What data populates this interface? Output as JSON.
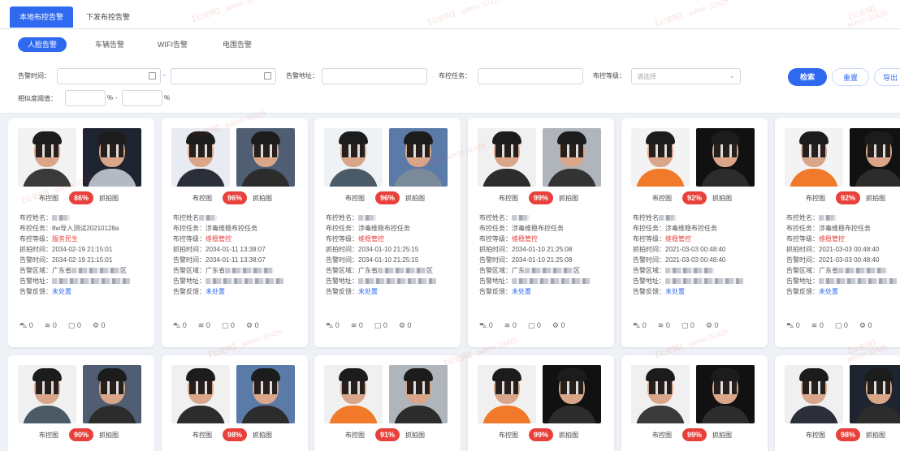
{
  "top_tabs": [
    {
      "label": "本地布控告警",
      "active": true
    },
    {
      "label": "下发布控告警",
      "active": false
    }
  ],
  "sub_tabs": [
    {
      "label": "人脸告警",
      "active": true
    },
    {
      "label": "车辆告警",
      "active": false
    },
    {
      "label": "WIFI告警",
      "active": false
    },
    {
      "label": "电围告警",
      "active": false
    }
  ],
  "filters": {
    "alarm_time_label": "告警时间：",
    "range_sep": "-",
    "alarm_addr_label": "告警地址：",
    "task_label": "布控任务：",
    "level_label": "布控等级：",
    "level_placeholder": "请选择",
    "similarity_label": "相似度阈值：",
    "percent_sign": "%",
    "search_label": "检索",
    "reset_label": "重置",
    "export_label": "导出"
  },
  "watermark": "【公安网】 admin 32425",
  "cards_row1": [
    {
      "caption_left": "布控图",
      "percent": "86%",
      "caption_right": "抓拍图",
      "name_label": "布控姓名：",
      "task_label": "布控任务：",
      "task": "8w导入测试20210128a",
      "level_label": "布控等级：",
      "level": "服务民生",
      "capture_time_label": "抓拍时间：",
      "capture_time": "2034-02-19 21:15:01",
      "alarm_time_label": "告警时间：",
      "alarm_time": "2034-02-19 21:15:01",
      "region_label": "告警区域：",
      "region": "广东省",
      "region_suffix": "区",
      "addr_label": "告警地址：",
      "feedback_label": "告警反馈：",
      "feedback": "未处置",
      "counts": [
        "0",
        "0",
        "0",
        "0"
      ]
    },
    {
      "caption_left": "布控图",
      "percent": "96%",
      "caption_right": "抓拍图",
      "name_label": "布控姓名",
      "task_label": "布控任务：",
      "task": "涉毒维稳布控任务",
      "level_label": "布控等级：",
      "level": "维稳管控",
      "capture_time_label": "抓拍时间：",
      "capture_time": "2034-01-11 13:38:07",
      "alarm_time_label": "告警时间：",
      "alarm_time": "2034-01-11 13:38:07",
      "region_label": "告警区域：",
      "region": "广东省",
      "region_suffix": "",
      "addr_label": "告警地址：",
      "feedback_label": "告警反馈：",
      "feedback": "未处置",
      "counts": [
        "0",
        "0",
        "0",
        "0"
      ]
    },
    {
      "caption_left": "布控图",
      "percent": "96%",
      "caption_right": "抓拍图",
      "name_label": "布控姓名：",
      "task_label": "布控任务：",
      "task": "涉毒维稳布控任务",
      "level_label": "布控等级：",
      "level": "维稳管控",
      "capture_time_label": "抓拍时间：",
      "capture_time": "2034-01-10 21:25:15",
      "alarm_time_label": "告警时间：",
      "alarm_time": "2034-01-10 21:25:15",
      "region_label": "告警区域：",
      "region": "广东省",
      "region_suffix": "区",
      "addr_label": "告警地址：",
      "feedback_label": "告警反馈：",
      "feedback": "未处置",
      "counts": [
        "0",
        "0",
        "0",
        "0"
      ]
    },
    {
      "caption_left": "布控图",
      "percent": "99%",
      "caption_right": "抓拍图",
      "name_label": "布控姓名：",
      "task_label": "布控任务：",
      "task": "涉毒维稳布控任务",
      "level_label": "布控等级：",
      "level": "维稳管控",
      "capture_time_label": "抓拍时间：",
      "capture_time": "2034-01-10 21:25:08",
      "alarm_time_label": "告警时间：",
      "alarm_time": "2034-01-10 21:25:08",
      "region_label": "告警区域：",
      "region": "广东",
      "region_suffix": "区",
      "addr_label": "告警地址：",
      "feedback_label": "告警反馈：",
      "feedback": "未处置",
      "counts": [
        "0",
        "0",
        "0",
        "0"
      ]
    },
    {
      "caption_left": "布控图",
      "percent": "92%",
      "caption_right": "抓拍图",
      "name_label": "布控姓名",
      "task_label": "布控任务：",
      "task": "涉毒维稳布控任务",
      "level_label": "布控等级：",
      "level": "维稳管控",
      "capture_time_label": "抓拍时间：",
      "capture_time": "2021-03-03 00:48:40",
      "alarm_time_label": "告警时间：",
      "alarm_time": "2021-03-03 00:48:40",
      "region_label": "告警区域：",
      "region": "",
      "region_suffix": "",
      "addr_label": "告警地址：",
      "feedback_label": "告警反馈：",
      "feedback": "未处置",
      "counts": [
        "0",
        "0",
        "0",
        "0"
      ]
    },
    {
      "caption_left": "布控图",
      "percent": "92%",
      "caption_right": "抓拍图",
      "name_label": "布控姓名：",
      "task_label": "布控任务：",
      "task": "涉毒维稳布控任务",
      "level_label": "布控等级：",
      "level": "维稳管控",
      "capture_time_label": "抓拍时间：",
      "capture_time": "2021-03-03 00:48:40",
      "alarm_time_label": "告警时间：",
      "alarm_time": "2021-03-03 00:48:40",
      "region_label": "告警区域：",
      "region": "广东省",
      "region_suffix": "",
      "addr_label": "告警地址：",
      "feedback_label": "告警反馈：",
      "feedback": "未处置",
      "counts": [
        "0",
        "0",
        "0",
        "0"
      ]
    }
  ],
  "cards_row2": [
    {
      "caption_left": "布控图",
      "percent": "90%",
      "caption_right": "抓拍图"
    },
    {
      "caption_left": "布控图",
      "percent": "98%",
      "caption_right": "抓拍图"
    },
    {
      "caption_left": "布控图",
      "percent": "91%",
      "caption_right": "抓拍图"
    },
    {
      "caption_left": "布控图",
      "percent": "99%",
      "caption_right": "抓拍图"
    },
    {
      "caption_left": "布控图",
      "percent": "99%",
      "caption_right": "抓拍图"
    },
    {
      "caption_left": "布控图",
      "percent": "98%",
      "caption_right": "抓拍图"
    }
  ],
  "icons": [
    "car-icon",
    "wifi-icon",
    "phone-icon",
    "gear-icon"
  ],
  "colors": {
    "accent": "#2e69f0",
    "alert": "#e8413b"
  }
}
